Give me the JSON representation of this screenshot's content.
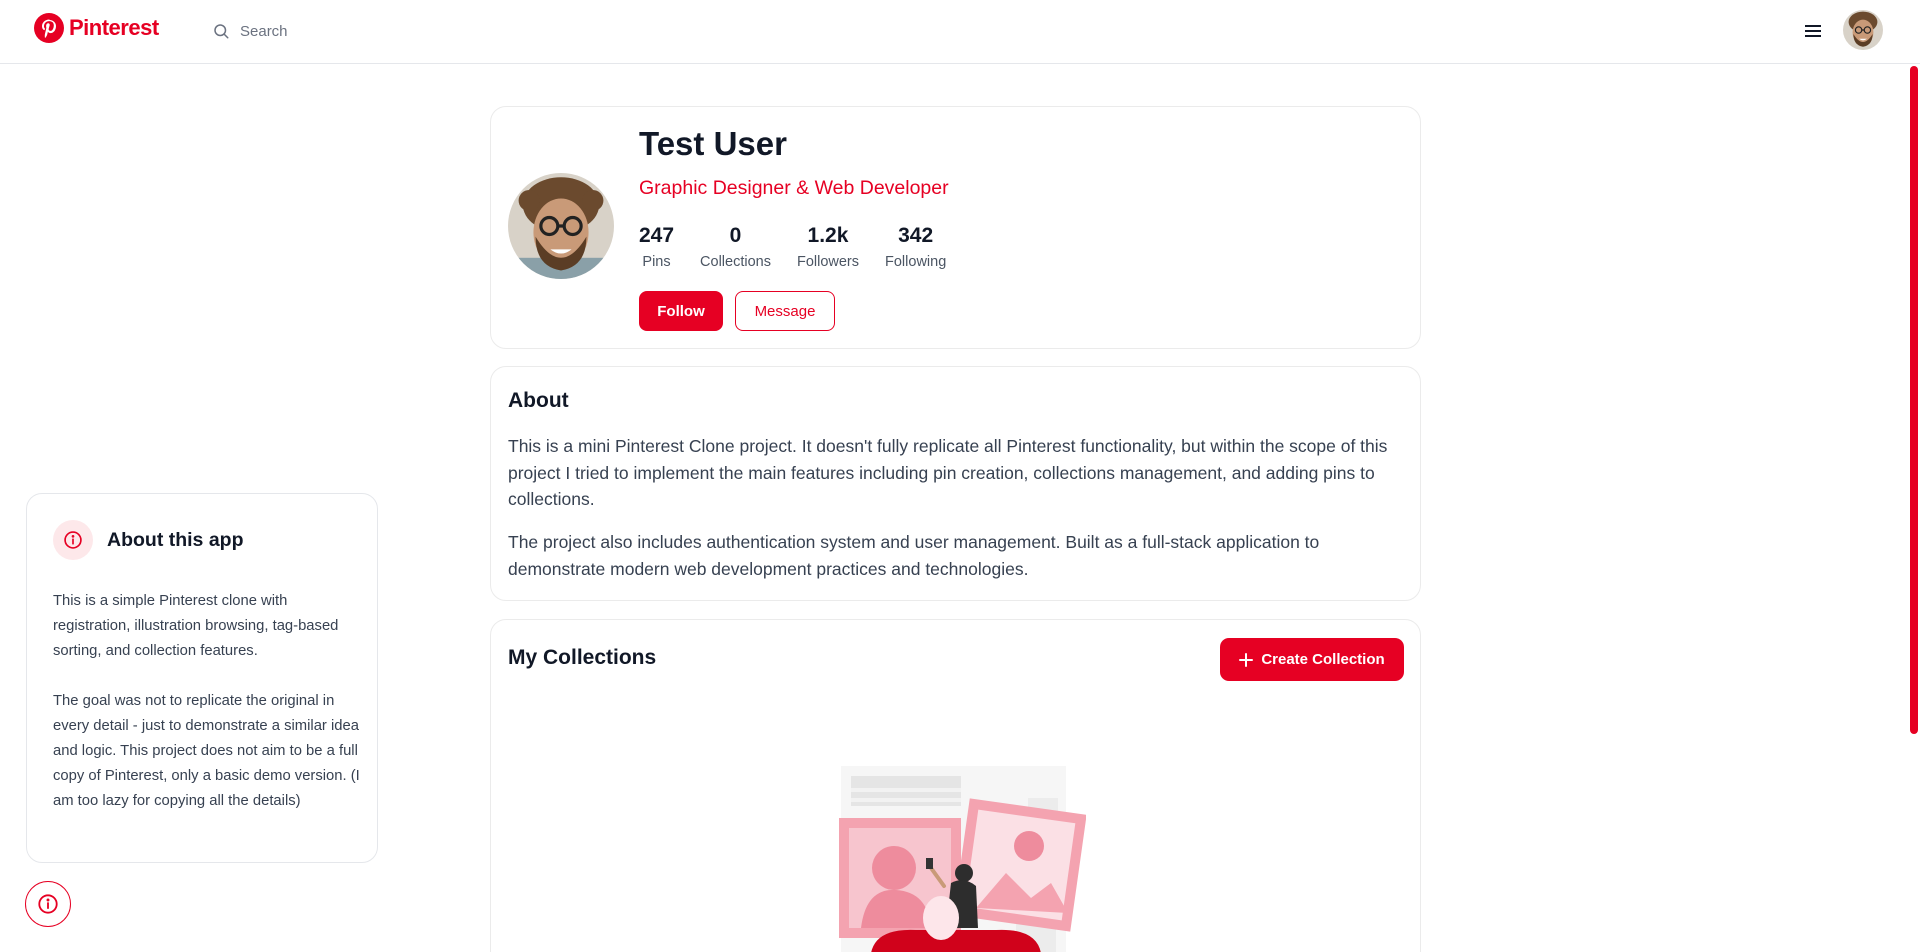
{
  "header": {
    "logo_text": "Pinterest",
    "search_placeholder": "Search"
  },
  "profile": {
    "name": "Test User",
    "role": "Graphic Designer & Web Developer",
    "stats": [
      {
        "value": "247",
        "label": "Pins"
      },
      {
        "value": "0",
        "label": "Collections"
      },
      {
        "value": "1.2k",
        "label": "Followers"
      },
      {
        "value": "342",
        "label": "Following"
      }
    ],
    "follow_label": "Follow",
    "message_label": "Message"
  },
  "about": {
    "title": "About",
    "paragraph1": "This is a mini Pinterest Clone project. It doesn't fully replicate all Pinterest functionality, but within the scope of this project I tried to implement the main features including pin creation, collections management, and adding pins to collections.",
    "paragraph2": "The project also includes authentication system and user management. Built as a full-stack application to demonstrate modern web development practices and technologies."
  },
  "collections": {
    "title": "My Collections",
    "create_label": "Create Collection"
  },
  "app_info": {
    "title": "About this app",
    "paragraph1": "This is a simple Pinterest clone with registration, illustration browsing, tag-based sorting, and collection features.",
    "paragraph2": "The goal was not to replicate the original in every detail - just to demonstrate a similar idea and logic. This project does not aim to be a full copy of Pinterest, only a basic demo version. (I am too lazy for copying all the details)"
  },
  "colors": {
    "brand": "#e60023",
    "text": "#111827",
    "muted": "#4b5563"
  },
  "icons": [
    "pinterest-logo-icon",
    "search-icon",
    "menu-icon",
    "info-icon",
    "plus-icon"
  ]
}
